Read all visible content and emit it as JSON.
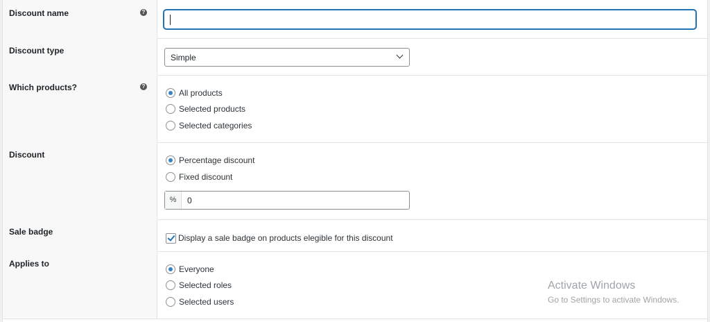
{
  "discount_name": {
    "label": "Discount name",
    "value": "",
    "help_icon": "question-circle-icon"
  },
  "discount_type": {
    "label": "Discount type",
    "selected": "Simple"
  },
  "which_products": {
    "label": "Which products?",
    "help_icon": "question-circle-icon",
    "options": [
      "All products",
      "Selected products",
      "Selected categories"
    ],
    "selected": "All products"
  },
  "discount": {
    "label": "Discount",
    "options": [
      "Percentage discount",
      "Fixed discount"
    ],
    "selected": "Percentage discount",
    "addon": "%",
    "value": "0"
  },
  "sale_badge": {
    "label": "Sale badge",
    "checkbox_label": "Display a sale badge on products elegible for this discount",
    "checked": true
  },
  "applies_to": {
    "label": "Applies to",
    "options": [
      "Everyone",
      "Selected roles",
      "Selected users"
    ],
    "selected": "Everyone"
  },
  "watermark": {
    "title": "Activate Windows",
    "subtitle": "Go to Settings to activate Windows."
  },
  "colors": {
    "accent": "#2271b1",
    "radio_checked": "#3582c4"
  }
}
